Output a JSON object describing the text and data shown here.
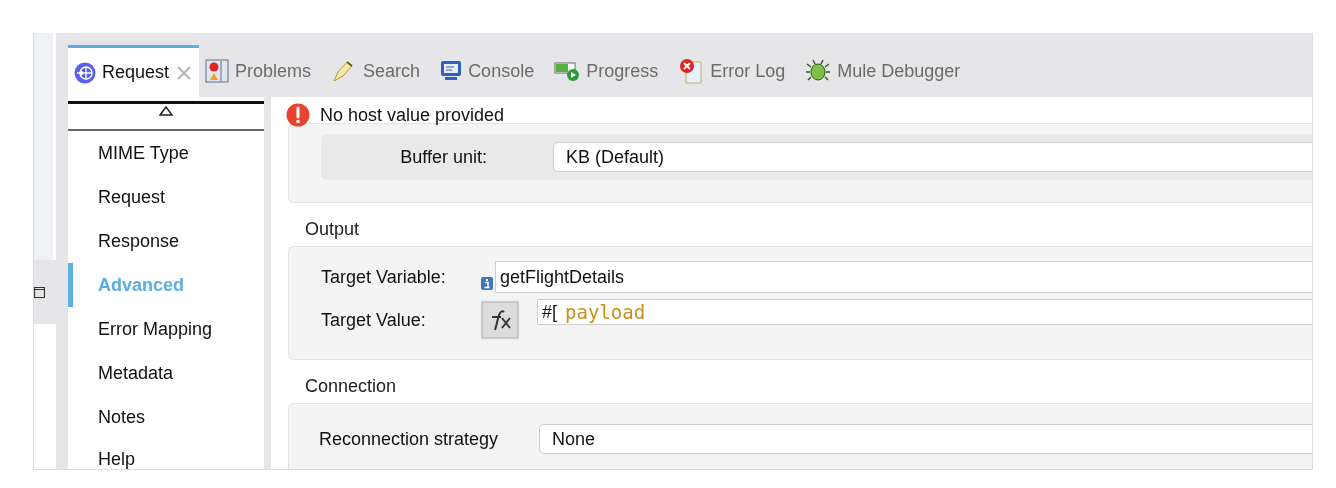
{
  "tabs": [
    {
      "label": "Request",
      "selected": true,
      "closable": true
    },
    {
      "label": "Problems",
      "selected": false,
      "closable": false
    },
    {
      "label": "Search",
      "selected": false,
      "closable": false
    },
    {
      "label": "Console",
      "selected": false,
      "closable": false
    },
    {
      "label": "Progress",
      "selected": false,
      "closable": false
    },
    {
      "label": "Error Log",
      "selected": false,
      "closable": false
    },
    {
      "label": "Mule Debugger",
      "selected": false,
      "closable": false
    }
  ],
  "nav": {
    "items": [
      {
        "label": "MIME Type",
        "selected": false
      },
      {
        "label": "Request",
        "selected": false
      },
      {
        "label": "Response",
        "selected": false
      },
      {
        "label": "Advanced",
        "selected": true
      },
      {
        "label": "Error Mapping",
        "selected": false
      },
      {
        "label": "Metadata",
        "selected": false
      },
      {
        "label": "Notes",
        "selected": false
      },
      {
        "label": "Help",
        "selected": false
      }
    ]
  },
  "error_message": "No host value provided",
  "buffer": {
    "label": "Buffer unit:",
    "value": "KB (Default)"
  },
  "output": {
    "title": "Output",
    "target_variable": {
      "label": "Target Variable:",
      "value": "getFlightDetails"
    },
    "target_value": {
      "label": "Target Value:",
      "prefix": "#[",
      "expression": "payload"
    }
  },
  "connection": {
    "title": "Connection",
    "reconnection": {
      "label": "Reconnection strategy",
      "value": "None"
    }
  }
}
